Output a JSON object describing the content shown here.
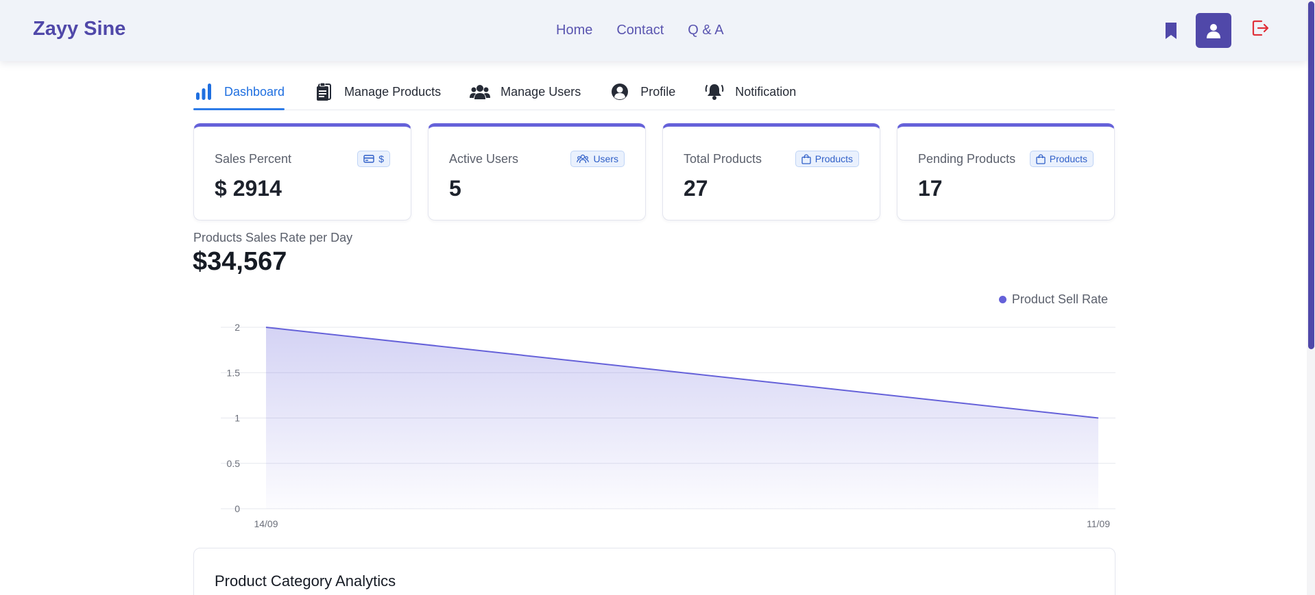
{
  "navbar": {
    "brand": "Zayy Sine",
    "links": [
      "Home",
      "Contact",
      "Q & A"
    ],
    "icons": [
      "bookmark-icon",
      "user-icon",
      "logout-icon"
    ]
  },
  "tabs": [
    {
      "label": "Dashboard",
      "icon": "bar-chart-icon",
      "active": true
    },
    {
      "label": "Manage Products",
      "icon": "clipboard-icon",
      "active": false
    },
    {
      "label": "Manage Users",
      "icon": "users-icon",
      "active": false
    },
    {
      "label": "Profile",
      "icon": "user-circle-icon",
      "active": false
    },
    {
      "label": "Notification",
      "icon": "bell-icon",
      "active": false
    }
  ],
  "cards": [
    {
      "label": "Sales Percent",
      "value": "$ 2914",
      "badge": "$",
      "badge_icon": "credit-card-icon"
    },
    {
      "label": "Active Users",
      "value": "5",
      "badge": "Users",
      "badge_icon": "users-icon"
    },
    {
      "label": "Total Products",
      "value": "27",
      "badge": "Products",
      "badge_icon": "shopping-bag-icon"
    },
    {
      "label": "Pending Products",
      "value": "17",
      "badge": "Products",
      "badge_icon": "shopping-bag-icon"
    }
  ],
  "sales": {
    "subtitle": "Products Sales Rate per Day",
    "total": "$34,567"
  },
  "chart_data": {
    "type": "area",
    "x": [
      "14/09",
      "11/09"
    ],
    "series": [
      {
        "name": "Product Sell Rate",
        "values": [
          2,
          1
        ],
        "color": "#6561d9"
      }
    ],
    "y_ticks": [
      "0",
      "0.5",
      "1",
      "1.5",
      "2"
    ],
    "ylim": [
      0,
      2
    ],
    "grid": true,
    "legend_position": "top-right"
  },
  "analytics": {
    "title": "Product Category Analytics"
  },
  "colors": {
    "accent": "#5048a9",
    "active_tab": "#1f6fe0",
    "series": "#6561d9",
    "logout": "#e0303a"
  }
}
